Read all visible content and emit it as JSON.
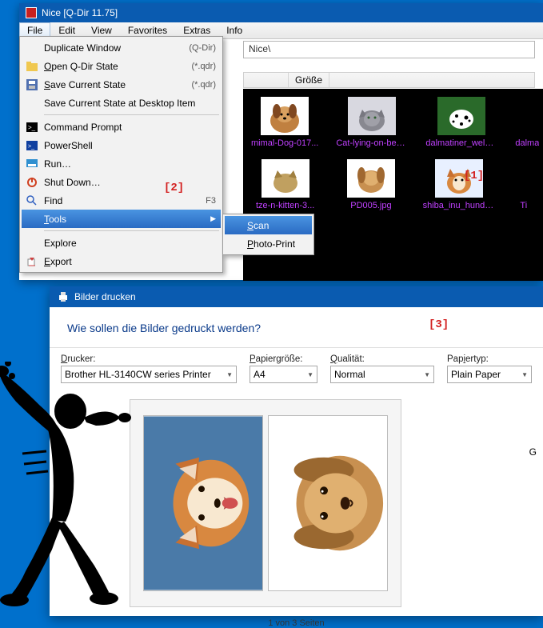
{
  "main": {
    "title": "Nice  [Q-Dir 11.75]"
  },
  "menubar": [
    "File",
    "Edit",
    "View",
    "Favorites",
    "Extras",
    "Info"
  ],
  "address_fragment": "Nice\\",
  "columns": {
    "size": "Größe"
  },
  "thumbs": {
    "row1": [
      "mimal-Dog-017...",
      "Cat-lying-on-bed...",
      "dalmatiner_welpe...",
      "dalma"
    ],
    "row2": [
      "tze-n-kitten-3...",
      "PD005.jpg",
      "shiba_inu_hund_l.jpg",
      "Ti"
    ]
  },
  "file_menu": {
    "duplicate": "Duplicate Window",
    "duplicate_acc": "(Q-Dir)",
    "open_state": "Open Q-Dir State",
    "open_state_acc": "(*.qdr)",
    "save_state": "Save Current State",
    "save_state_acc": "(*.qdr)",
    "save_desktop": "Save Current State at Desktop Item",
    "cmd": "Command Prompt",
    "powershell": "PowerShell",
    "run": "Run…",
    "shutdown": "Shut Down…",
    "find": "Find",
    "find_acc": "F3",
    "tools": "Tools",
    "explore": "Explore",
    "export": "Export"
  },
  "submenu": {
    "scan": "Scan",
    "photo_print": "Photo-Print"
  },
  "annotations": {
    "a1": "[1]",
    "a2": "[2]",
    "a3": "[3]"
  },
  "print": {
    "title": "Bilder drucken",
    "heading": "Wie sollen die Bilder gedruckt werden?",
    "printer_label": "Drucker:",
    "printer_value": "Brother HL-3140CW series Printer",
    "paper_size_label": "Papiergröße:",
    "paper_size_value": "A4",
    "quality_label": "Qualität:",
    "quality_value": "Normal",
    "paper_type_label": "Papiertyp:",
    "paper_type_value": "Plain Paper",
    "side_g": "G",
    "page_status": "1 von 3 Seiten"
  }
}
